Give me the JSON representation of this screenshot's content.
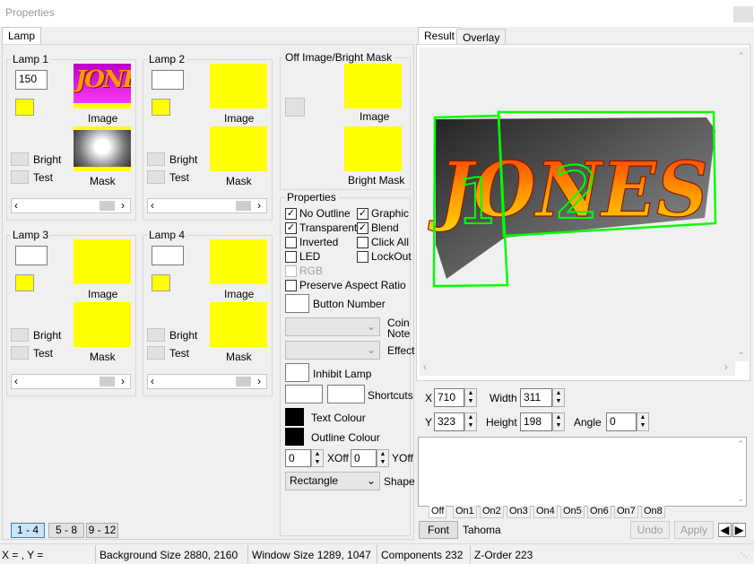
{
  "window": {
    "title": "Properties"
  },
  "left_tabs": [
    {
      "label": "Lamp"
    }
  ],
  "right_tabs": [
    {
      "label": "Result"
    },
    {
      "label": "Overlay"
    }
  ],
  "lamps": [
    {
      "title": "Lamp 1",
      "value": "150",
      "image_label": "Image",
      "mask_label": "Mask",
      "bright_label": "Bright",
      "test_label": "Test"
    },
    {
      "title": "Lamp 2",
      "value": "",
      "image_label": "Image",
      "mask_label": "Mask",
      "bright_label": "Bright",
      "test_label": "Test"
    },
    {
      "title": "Lamp 3",
      "value": "",
      "image_label": "Image",
      "mask_label": "Mask",
      "bright_label": "Bright",
      "test_label": "Test"
    },
    {
      "title": "Lamp 4",
      "value": "",
      "image_label": "Image",
      "mask_label": "Mask",
      "bright_label": "Bright",
      "test_label": "Test"
    }
  ],
  "off_image": {
    "title": "Off Image/Bright Mask",
    "image_label": "Image",
    "bright_mask_label": "Bright Mask"
  },
  "lamp_image": {
    "text": "JONES"
  },
  "properties": {
    "title": "Properties",
    "checks": [
      {
        "label": "No Outline",
        "checked": true
      },
      {
        "label": "Graphic",
        "checked": true
      },
      {
        "label": "Transparent",
        "checked": true
      },
      {
        "label": "Blend",
        "checked": true
      },
      {
        "label": "Inverted",
        "checked": false
      },
      {
        "label": "Click All",
        "checked": false
      },
      {
        "label": "LED",
        "checked": false
      },
      {
        "label": "LockOut",
        "checked": false
      },
      {
        "label": "RGB",
        "checked": false,
        "disabled": true
      },
      {
        "label": "Preserve Aspect Ratio",
        "checked": false
      }
    ],
    "button_number_label": "Button Number",
    "coin_note_label_1": "Coin",
    "coin_note_label_2": "Note",
    "effect_label": "Effect",
    "inhibit_lamp_label": "Inhibit Lamp",
    "shortcuts_label": "Shortcuts",
    "text_colour_label": "Text Colour",
    "outline_colour_label": "Outline Colour",
    "text_colour": "#000000",
    "outline_colour": "#000000",
    "xoff_value": "0",
    "xoff_label": "XOff",
    "yoff_value": "0",
    "yoff_label": "YOff",
    "shape_value": "Rectangle",
    "shape_label": "Shape"
  },
  "pages": [
    {
      "label": "1 - 4",
      "active": true
    },
    {
      "label": "5 - 8",
      "active": false
    },
    {
      "label": "9 - 12",
      "active": false
    }
  ],
  "result": {
    "text": "JONES",
    "overlay_labels": [
      "1",
      "2"
    ],
    "overlay_color": "#00ff00"
  },
  "position": {
    "x_label": "X",
    "x": "710",
    "y_label": "Y",
    "y": "323",
    "width_label": "Width",
    "width": "311",
    "height_label": "Height",
    "height": "198",
    "angle_label": "Angle",
    "angle": "0"
  },
  "state_tabs": [
    "Off",
    "On1",
    "On2",
    "On3",
    "On4",
    "On5",
    "On6",
    "On7",
    "On8"
  ],
  "font": {
    "button_label": "Font",
    "name": "Tahoma"
  },
  "actions": {
    "undo": "Undo",
    "apply": "Apply"
  },
  "status": {
    "coords": "X = , Y =",
    "background": "Background Size 2880, 2160",
    "window": "Window Size 1289, 1047",
    "components": "Components 232",
    "zorder": "Z-Order 223"
  }
}
